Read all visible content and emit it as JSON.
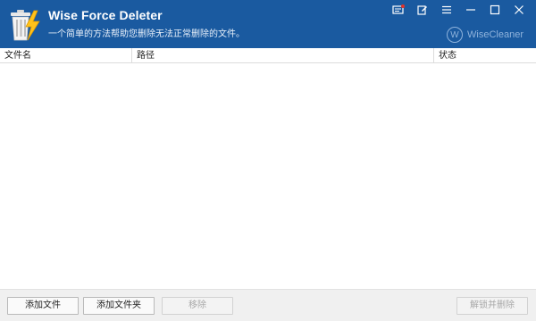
{
  "app": {
    "title": "Wise Force Deleter",
    "subtitle": "一个简单的方法帮助您删除无法正常删除的文件。",
    "brand": "WiseCleaner",
    "brand_mark": "W"
  },
  "table": {
    "columns": [
      "文件名",
      "路径",
      "状态"
    ],
    "rows": []
  },
  "buttons": {
    "add_file": "添加文件",
    "add_folder": "添加文件夹",
    "remove": "移除",
    "unlock_delete": "解锁并删除"
  },
  "colors": {
    "titlebar": "#1a5aa0",
    "notification_dot": "#e0322a"
  },
  "icons": [
    "app-logo-icon",
    "message-icon",
    "feedback-icon",
    "menu-icon",
    "minimize-icon",
    "maximize-icon",
    "close-icon"
  ]
}
